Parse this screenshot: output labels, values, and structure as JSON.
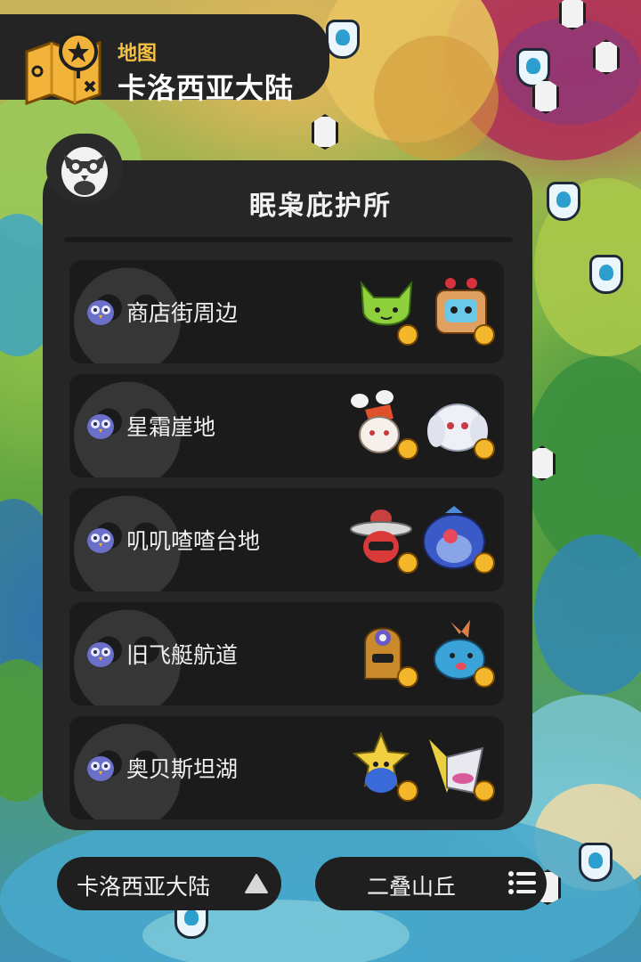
{
  "header": {
    "icon": "treasure-map-icon",
    "label": "地图",
    "region": "卡洛西亚大陆"
  },
  "panel": {
    "title": "眠枭庇护所",
    "items": [
      {
        "label": "商店街周边",
        "icon": "owl-icon",
        "pals": [
          "green-cat-pal",
          "robot-box-pal"
        ]
      },
      {
        "label": "星霜崖地",
        "icon": "owl-icon",
        "pals": [
          "white-rabbit-pal",
          "white-ghost-bunny-pal"
        ]
      },
      {
        "label": "叽叽喳喳台地",
        "icon": "owl-icon",
        "pals": [
          "hat-bird-pal",
          "blue-bear-pal"
        ]
      },
      {
        "label": "旧飞艇航道",
        "icon": "owl-icon",
        "pals": [
          "brown-blob-pal",
          "blue-fish-pal"
        ]
      },
      {
        "label": "奥贝斯坦湖",
        "icon": "owl-icon",
        "pals": [
          "yellow-star-pal",
          "white-shark-pal"
        ]
      }
    ]
  },
  "footer": {
    "region_button": "卡洛西亚大陆",
    "area_button": "二叠山丘"
  },
  "colors": {
    "panel_bg": "#262626",
    "item_bg": "#1b1b1b",
    "accent": "#f5c243",
    "owl_badge": "#6a6fc8"
  }
}
